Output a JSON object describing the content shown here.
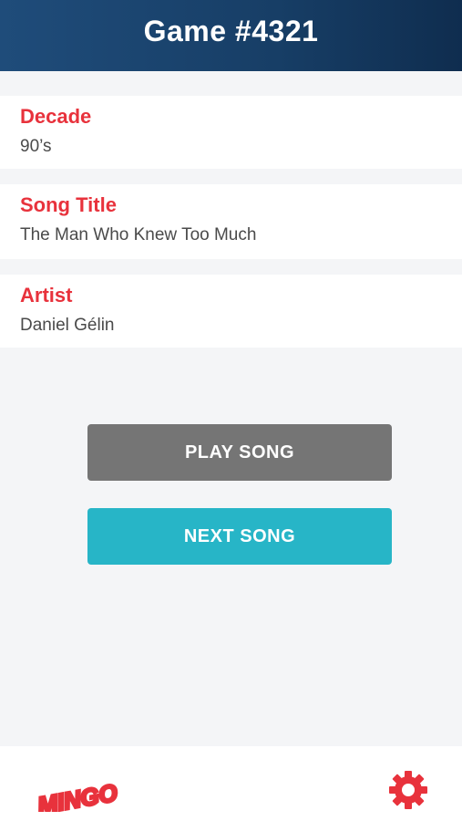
{
  "header": {
    "title": "Game #4321"
  },
  "cards": {
    "decade": {
      "label": "Decade",
      "value": "90’s"
    },
    "song_title": {
      "label": "Song Title",
      "value": "The Man Who Knew Too Much"
    },
    "artist": {
      "label": "Artist",
      "value": "Daniel Gélin"
    }
  },
  "buttons": {
    "play": "PLAY SONG",
    "next": "NEXT SONG"
  },
  "footer": {
    "logo_text": "MINGO",
    "settings_icon": "gear-icon"
  },
  "colors": {
    "accent_red": "#e8323c",
    "header_blue": "#173e66",
    "play_gray": "#757575",
    "next_teal": "#27b5c7"
  }
}
